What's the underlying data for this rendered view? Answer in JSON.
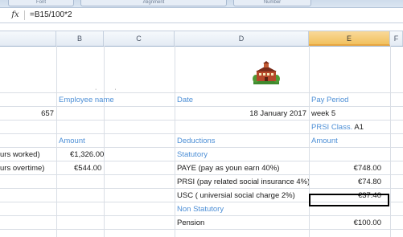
{
  "ribbon": {
    "group_labels": [
      "Font",
      "Alignment",
      "Number"
    ]
  },
  "formula_bar": {
    "fx_label": "fx",
    "formula": "=B15/100*2"
  },
  "columns": [
    "B",
    "C",
    "D",
    "E",
    "F"
  ],
  "sheet": {
    "headers": {
      "employee_name": "Employee name",
      "date": "Date",
      "pay_period": "Pay Period"
    },
    "row_id": {
      "employee_no": "657",
      "date_value": "18 January 2017",
      "week": "week 5"
    },
    "prsi": {
      "label": "PRSI",
      "class_label": "Class.",
      "class_value": "A1"
    },
    "section_headers": {
      "amount_left": "Amount",
      "deductions": "Deductions",
      "amount_right": "Amount"
    },
    "hours_worked": {
      "label": "urs worked)",
      "value": "€1,326.00"
    },
    "hours_overtime": {
      "label": "urs overtime)",
      "value": "€544.00"
    },
    "statutory": "Statutory",
    "deductions": [
      {
        "label": "PAYE (pay as youn earn 40%)",
        "value": "€748.00"
      },
      {
        "label": "PRSI (pay related social insurance 4%)",
        "value": "€74.80"
      },
      {
        "label": "USC ( universial social charge 2%)",
        "value": "€37.40"
      }
    ],
    "non_statutory": "Non Statutory",
    "pension": {
      "label": "Pension",
      "value": "€100.00"
    }
  }
}
